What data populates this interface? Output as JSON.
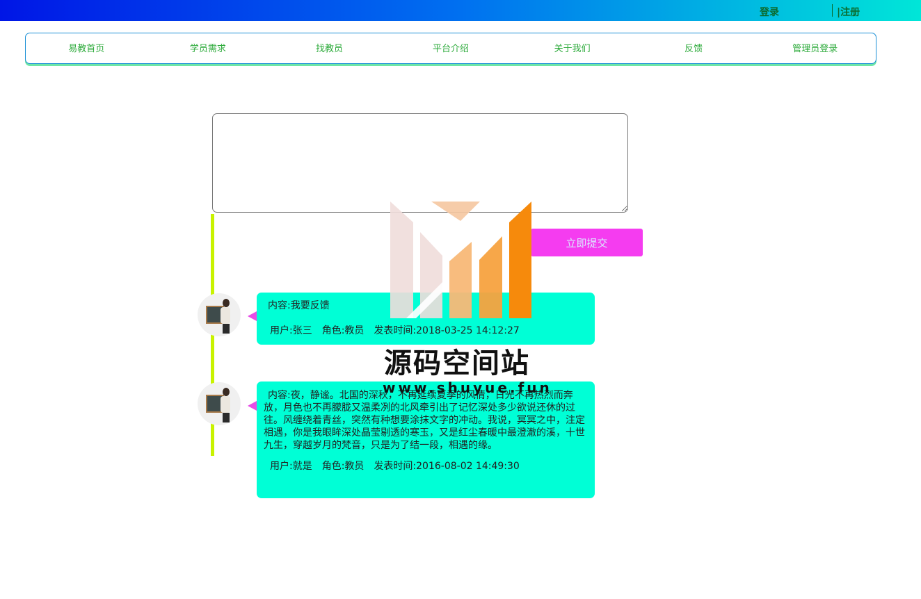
{
  "header": {
    "login": "登录",
    "register": "|注册"
  },
  "nav": [
    {
      "label": "易教首页"
    },
    {
      "label": "学员需求"
    },
    {
      "label": "找教员"
    },
    {
      "label": "平台介绍"
    },
    {
      "label": "关于我们"
    },
    {
      "label": "反馈"
    },
    {
      "label": "管理员登录"
    }
  ],
  "form": {
    "textarea_value": "",
    "submit_label": "立即提交"
  },
  "feedback": [
    {
      "content": "内容:我要反馈",
      "user": "用户:张三",
      "role": "角色:教员",
      "time": "发表时间:2018-03-25 14:12:27"
    },
    {
      "content": "内容:夜，静谧。北国的深秋，不再延续夏季的风情，日光不再热烈而奔放，月色也不再朦胧又温柔冽的北风牵引出了记忆深处多少欲说还休的过往。风缠绕着青丝，突然有种想要涂抹文字的冲动。我说，冥冥之中，注定相遇，你是我眼眸深处晶莹剔透的寒玉，又是红尘春暖中最澄澈的溪，十世九生，穿越岁月的梵音，只是为了结一段，相遇的缘。",
      "user": "用户:就是",
      "role": "角色:教员",
      "time": "发表时间:2016-08-02 14:49:30"
    }
  ],
  "watermark": {
    "title": "源码空间站",
    "url": "www.shuyue.fun"
  },
  "colors": {
    "nav_text": "#2eab3c",
    "bubble": "#00ffd6",
    "submit": "#f53cf0",
    "timeline": "#c8f200"
  }
}
